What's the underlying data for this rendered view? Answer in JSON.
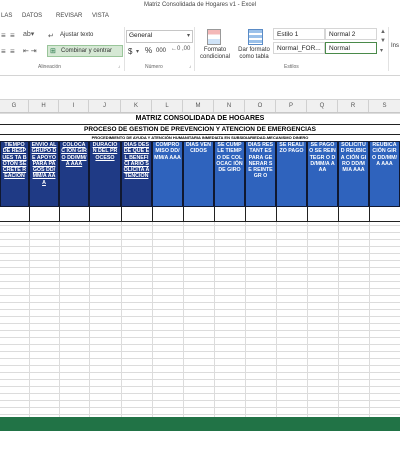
{
  "window": {
    "title": "Matriz Consolidada de Hogares v1 - Excel"
  },
  "tabs": [
    "LAS",
    "DATOS",
    "REVISAR",
    "VISTA"
  ],
  "ribbon": {
    "wrap_text": "Ajustar texto",
    "merge_center": "Combinar y centrar",
    "alignment_group": "Alineación",
    "number_format": "General",
    "currency": "$",
    "percent": "%",
    "thousands": "000",
    "number_group": "Número",
    "conditional_format": "Formato condicional",
    "format_table": "Dar formato como tabla",
    "styles_group": "Estilos",
    "styles": [
      "Estilo 1",
      "Normal 2",
      "Normal_FOR...",
      "Normal"
    ],
    "insert_partial": "Ins"
  },
  "columns": [
    "G",
    "H",
    "I",
    "J",
    "K",
    "L",
    "M",
    "N",
    "O",
    "P",
    "Q",
    "R",
    "S"
  ],
  "sheet": {
    "title": "MATRIZ CONSOLIDADA DE HOGARES",
    "subtitle": "PROCESO DE GESTION DE PREVENCION Y ATENCION DE EMERGENCIAS",
    "procedure": "PROCEDIMIENTO DE AYUDA Y ATENCIÓN HUMANITARIA INMEDIATA EN SUBSIDIARIEDAD-MECANISMO DINERO",
    "headers": [
      "TIEMPO DE RESPUES TA BOTON SECRETE REACION",
      "ENVIO AL GRUPO DE APOYO PARA PAGOS DD/MM/A AAA",
      "COLOCAC IÓN GIRO DD/MM/A AAA",
      "DURACIÓ N DEL PROCESO",
      "DÍAS DESDE QUE EL BENEFICI ARIO SOLICITA ATENCIÓN",
      "COMPRO MISO DD/MM/A AAA",
      "DIAS VENCIDOS",
      "SE CUMPLE TIEMPO DE COLOCAC IÓN DE GIRO",
      "DÍAS RESTANT ES PARA GENERAR SE REINTEGR O",
      "SE REALIZO PAGO",
      "SE PAGO O SE REINTEGR O DD/MM/A AAA",
      "SOLICITU D REUBICA CIÓN GIRO DD/MM/A AAA",
      "REUBICA CIÓN GIRO DD/MM/A AAA"
    ]
  },
  "colors": {
    "accent": "#217346",
    "header_dark": "#1f3a85",
    "header_light": "#2f63bd"
  }
}
